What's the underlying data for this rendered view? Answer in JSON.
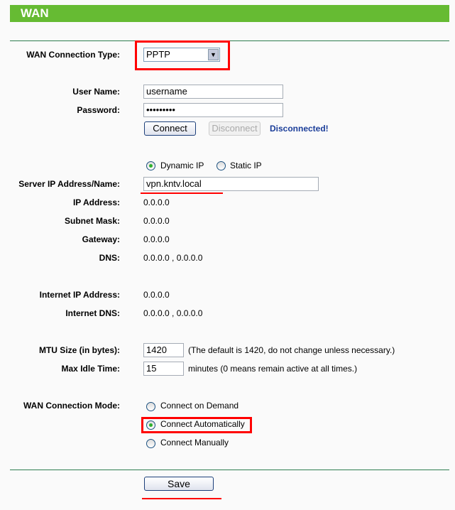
{
  "header": {
    "title": "WAN"
  },
  "wan_type": {
    "label": "WAN Connection Type:",
    "value": "PPTP"
  },
  "user": {
    "label": "User Name:",
    "value": "username"
  },
  "password": {
    "label": "Password:",
    "value": "•••••••••"
  },
  "connect_label": "Connect",
  "disconnect_label": "Disconnect",
  "status": "Disconnected!",
  "ip_mode": {
    "dynamic": "Dynamic IP",
    "static": "Static IP",
    "selected": "dynamic"
  },
  "server": {
    "label": "Server IP Address/Name:",
    "value": "vpn.kntv.local"
  },
  "fields": [
    {
      "label": "IP Address:",
      "value": "0.0.0.0"
    },
    {
      "label": "Subnet Mask:",
      "value": "0.0.0.0"
    },
    {
      "label": "Gateway:",
      "value": "0.0.0.0"
    },
    {
      "label": "DNS:",
      "value": "0.0.0.0 , 0.0.0.0"
    },
    {
      "label": "Internet IP Address:",
      "value": "0.0.0.0"
    },
    {
      "label": "Internet DNS:",
      "value": "0.0.0.0 , 0.0.0.0"
    }
  ],
  "mtu": {
    "label": "MTU Size (in bytes):",
    "value": "1420",
    "hint": "(The default is 1420, do not change unless necessary.)"
  },
  "idle": {
    "label": "Max Idle Time:",
    "value": "15",
    "hint": "minutes (0 means remain active at all times.)"
  },
  "mode": {
    "label": "WAN Connection Mode:",
    "options": [
      "Connect on Demand",
      "Connect Automatically",
      "Connect Manually"
    ],
    "selected": 1
  },
  "save_label": "Save",
  "colors": {
    "header": "#66bb33",
    "highlight": "#ff0000",
    "status": "#1a3d99"
  }
}
